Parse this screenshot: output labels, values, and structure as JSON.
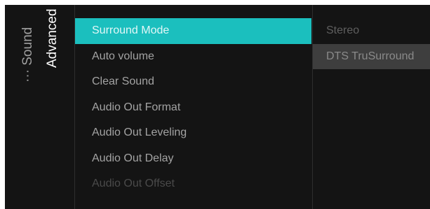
{
  "breadcrumb": {
    "parent_label": "··· Sound",
    "current_label": "Advanced"
  },
  "menu": {
    "items": [
      {
        "label": "Surround Mode"
      },
      {
        "label": "Auto volume"
      },
      {
        "label": "Clear Sound"
      },
      {
        "label": "Audio Out Format"
      },
      {
        "label": "Audio Out Leveling"
      },
      {
        "label": "Audio Out Delay"
      },
      {
        "label": "Audio Out Offset"
      }
    ]
  },
  "options": {
    "items": [
      {
        "label": "Stereo"
      },
      {
        "label": "DTS TruSurround"
      }
    ]
  },
  "colors": {
    "background": "#141414",
    "accent": "#1bbfbe",
    "option_highlight": "#3e3e3e"
  }
}
